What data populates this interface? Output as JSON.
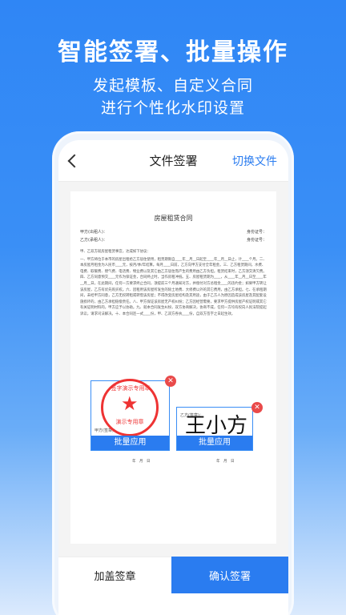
{
  "promo": {
    "title": "智能签署、批量操作",
    "line1": "发起模板、自定义合同",
    "line2": "进行个性化水印设置"
  },
  "nav": {
    "title": "文件签署",
    "switch_label": "切换文件"
  },
  "document": {
    "title": "房屋租赁合同",
    "party_a": "甲方(出租人)：",
    "party_b": "乙方(承租人)：",
    "id_a": "身份证号：",
    "id_b": "身份证号：",
    "intro": "甲、乙双方就房屋租赁事宜，达成如下协议：",
    "body": "一、甲方将位于本市的房屋出租给乙方居住使用，租赁期限自____年__月__日起至____年__月__日止，计____个月。二、本房屋月租金为人民币____元，按月/季/年结算。每月____日前，乙方向甲方支付全年租金。三、乙方租赁期间，水费、电费、取暖费、燃气费、电话费、物业费以及其它由乙方居住而产生的费用由乙方负担。租赁结束时，乙方须交清欠费。四、乙方同意预交____元作为保证金，合同终止时，当作房租冲抵。五、房屋租赁期为____，从____年__月__日至____年__月__日。在此期间，任何一方要求终止合同，须提前三个月通知对方，并偿付对方总租金____的违约金；如果甲方转让该房屋，乙方有优先购买权。六、因租用该房屋所发生的除土地费、大修费以外的其它费用，由乙方承担。七、在承租期间，未经甲方同意，乙方无权转租或转借该房屋；不得改变房屋结构及其用途，由于乙方人为原因造成该房屋及其配套设施损坏的，由乙方承担赔偿责任。八、甲方保证该房屋无产权纠纷；乙方因经营需要，要求甲方提供房屋产权证明或其它有关证明材料的，甲方应予以协助。九、就本合同发生纠纷，双方协商解决，协商不成，任何一方均有权向人民法院提起诉讼，请求司法解决。十、本合同连一式____份，甲、乙双方各执____份，自双方签字之日起生效。",
    "sign_a": "甲方(签章)：",
    "sign_b": "乙方(签章)：",
    "date": "年　月　日"
  },
  "seal": {
    "ring_text": "签字演示专用章",
    "band_text": "演示专用章"
  },
  "signature": {
    "text": "王小方"
  },
  "sig_boxes": {
    "apply_label": "批量应用",
    "delete_glyph": "✕"
  },
  "bottom": {
    "stamp_label": "加盖签章",
    "confirm_label": "确认签署"
  },
  "colors": {
    "accent": "#2a7cf0",
    "delete": "#e94a4a",
    "seal": "#e33333"
  }
}
